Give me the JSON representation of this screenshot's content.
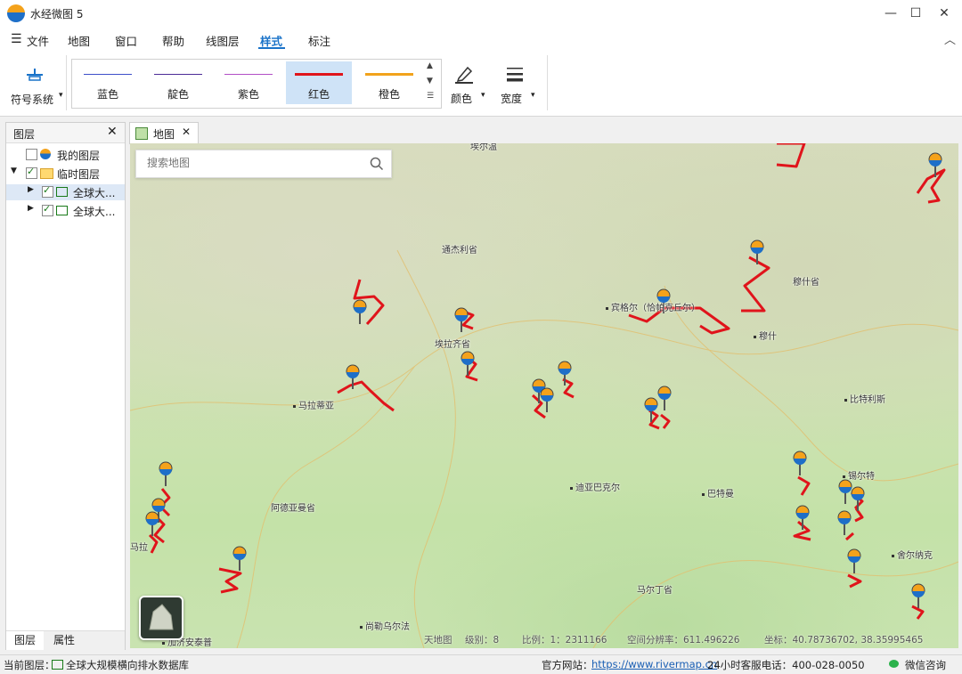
{
  "app": {
    "title": "水经微图 5"
  },
  "window_controls": {
    "minimize": "—",
    "maximize": "☐",
    "close": "✕"
  },
  "menu": {
    "file": "文件",
    "tabs": [
      {
        "label": "地图"
      },
      {
        "label": "窗口"
      },
      {
        "label": "帮助"
      },
      {
        "label": "线图层"
      },
      {
        "label": "样式"
      },
      {
        "label": "标注"
      }
    ],
    "active_tab": "样式"
  },
  "ribbon": {
    "symbol_system": "符号系统",
    "line_styles": [
      {
        "label": "蓝色",
        "color": "#3d4fc9"
      },
      {
        "label": "靛色",
        "color": "#4b2c96"
      },
      {
        "label": "紫色",
        "color": "#b24fc6"
      },
      {
        "label": "红色",
        "color": "#e0141b"
      },
      {
        "label": "橙色",
        "color": "#f2a31b"
      }
    ],
    "selected_style": "红色",
    "color_button": "颜色",
    "width_button": "宽度"
  },
  "layers_panel": {
    "title": "图层",
    "items": [
      {
        "label": "我的图层"
      },
      {
        "label": "临时图层"
      },
      {
        "label": "全球大..."
      },
      {
        "label": "全球大..."
      }
    ],
    "bottom_tabs": [
      "图层",
      "属性"
    ]
  },
  "map_tab": {
    "label": "地图"
  },
  "search": {
    "placeholder": "搜索地图"
  },
  "map_labels": {
    "top_place": "埃尔温",
    "gongjieli": "通杰利省",
    "bingol": "宾格尔（恰帕克丘尔）",
    "mush_prov": "穆什省",
    "elazig": "埃拉齐省",
    "malatya": "马拉蒂亚",
    "mush": "穆什",
    "bitlis": "比特利斯",
    "diyarbakir": "迪亚巴克尔",
    "batman": "巴特曼",
    "adiyaman": "阿德亚曼省",
    "siirt": "锡尔特",
    "pazarcik": "马拉什",
    "sirnak": "舍尔纳克",
    "mardin": "马尔丁省",
    "sanliurfa": "尚勒乌尔法",
    "gaziantep": "加济安泰普",
    "bl_edge": "马拉"
  },
  "map_info": {
    "source": "天地图",
    "level": "级别：8",
    "scale": "比例：1：2311166",
    "resolution": "空间分辨率：611.496226",
    "coords": "坐标：40.78736702, 38.35995465"
  },
  "status": {
    "current_layer_label": "当前图层：",
    "current_layer": "全球大规模横向排水数据库",
    "website_label": "官方网站：",
    "website": "https://www.rivermap.cn",
    "hotline": "24小时客服电话：400-028-0050",
    "wechat": "微信咨询"
  }
}
